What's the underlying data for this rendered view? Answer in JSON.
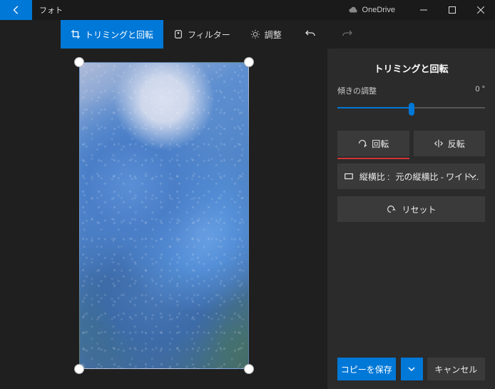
{
  "titlebar": {
    "app_name": "フォト",
    "onedrive_label": "OneDrive"
  },
  "toolbar": {
    "crop_rotate": "トリミングと回転",
    "filter": "フィルター",
    "adjust": "調整"
  },
  "sidebar": {
    "title": "トリミングと回転",
    "straighten_label": "傾きの調整",
    "straighten_value": "0 °",
    "rotate_label": "回転",
    "flip_label": "反転",
    "aspect_label": "縦横比 :",
    "aspect_value": "元の縦横比 - ワイド...",
    "reset_label": "リセット"
  },
  "footer": {
    "save_label": "コピーを保存",
    "cancel_label": "キャンセル"
  }
}
